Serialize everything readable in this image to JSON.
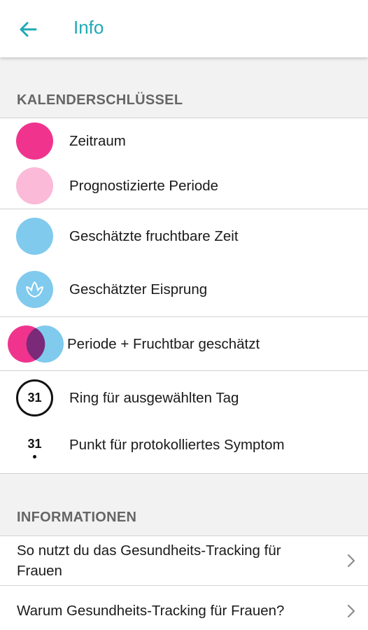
{
  "header": {
    "title": "Info"
  },
  "key_section": {
    "title": "KALENDERSCHLÜSSEL",
    "items": [
      {
        "label": "Zeitraum",
        "icon": "period-dot-icon",
        "color": "#f0348e"
      },
      {
        "label": "Prognostizierte Periode",
        "icon": "predicted-period-dot-icon",
        "color": "#fbbad8"
      },
      {
        "label": "Geschätzte fruchtbare Zeit",
        "icon": "fertile-dot-icon",
        "color": "#80caee"
      },
      {
        "label": "Geschätzter Eisprung",
        "icon": "ovulation-flower-icon",
        "color": "#80caee"
      },
      {
        "label": "Periode + Fruchtbar geschätzt",
        "icon": "period-fertile-overlap-icon"
      },
      {
        "label": "Ring für ausgewählten Tag",
        "icon": "selected-day-ring-icon",
        "day": "31"
      },
      {
        "label": "Punkt für protokolliertes Symptom",
        "icon": "logged-symptom-dot-icon",
        "day": "31"
      }
    ]
  },
  "info_section": {
    "title": "INFORMATIONEN",
    "items": [
      {
        "label": "So nutzt du das Gesundheits-Tracking für Frauen"
      },
      {
        "label": "Warum Gesundheits-Tracking für Frauen?"
      }
    ]
  },
  "colors": {
    "accent": "#1eaab5",
    "period": "#f0348e",
    "predicted": "#fbbad8",
    "fertile": "#80caee",
    "overlap": "#7a2a79"
  }
}
